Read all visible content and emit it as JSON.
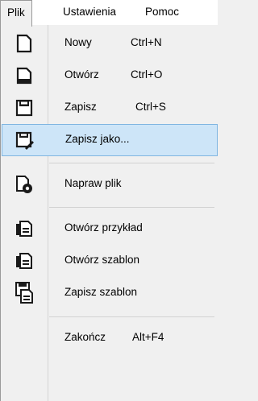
{
  "menubar": {
    "items": [
      {
        "label": "Plik"
      },
      {
        "label": "Ustawienia"
      },
      {
        "label": "Pomoc"
      }
    ]
  },
  "menu": {
    "items": [
      {
        "label": "Nowy",
        "shortcut": "Ctrl+N",
        "icon": "new-file-icon"
      },
      {
        "label": "Otwórz",
        "shortcut": "Ctrl+O",
        "icon": "open-file-icon"
      },
      {
        "label": "Zapisz",
        "shortcut": "Ctrl+S",
        "icon": "save-icon"
      },
      {
        "label": "Zapisz jako...",
        "shortcut": "",
        "icon": "save-as-icon",
        "selected": true
      },
      {
        "label": "Napraw plik",
        "shortcut": "",
        "icon": "repair-file-icon"
      },
      {
        "label": "Otwórz przykład",
        "shortcut": "",
        "icon": "open-example-icon"
      },
      {
        "label": "Otwórz szablon",
        "shortcut": "",
        "icon": "open-template-icon"
      },
      {
        "label": "Zapisz szablon",
        "shortcut": "",
        "icon": "save-template-icon"
      },
      {
        "label": "Zakończ",
        "shortcut": "Alt+F4",
        "icon": ""
      }
    ]
  },
  "colors": {
    "selection_fill": "#cde5f8",
    "selection_border": "#7fb5e1",
    "icon_dark": "#1a1a1a"
  }
}
